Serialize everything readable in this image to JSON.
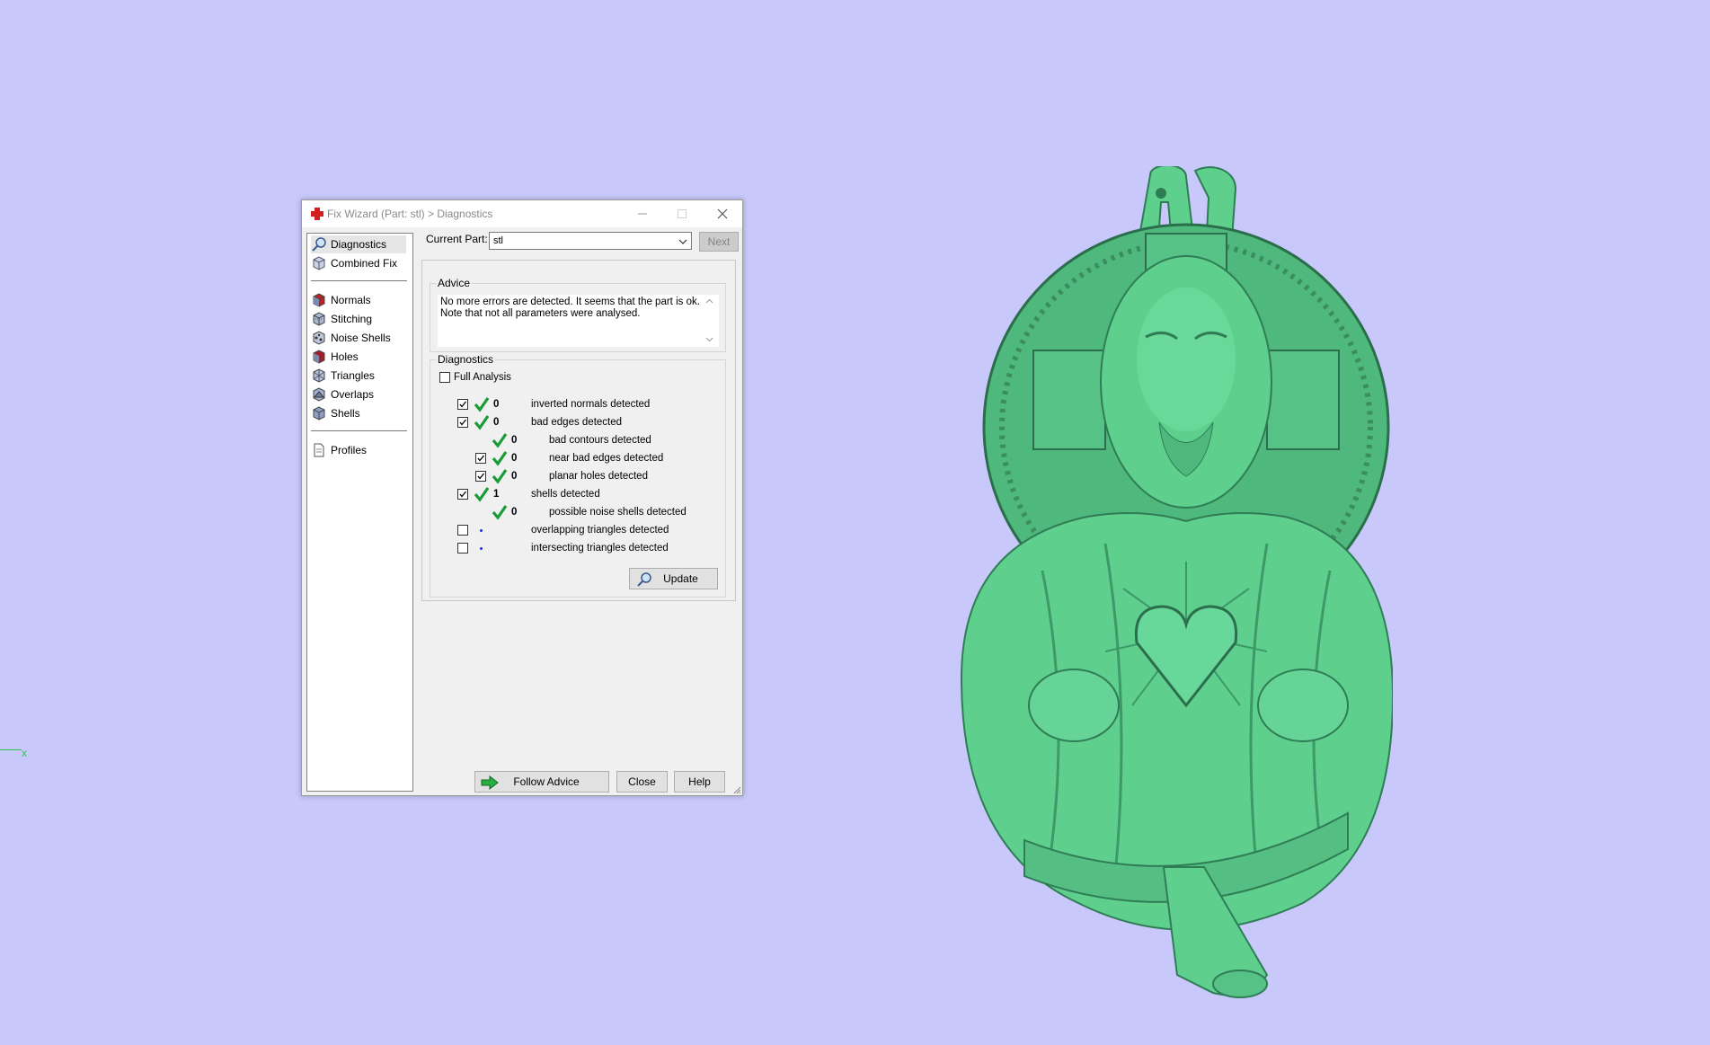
{
  "viewport": {
    "axis_label": "x",
    "background_color": "#c8c8fa",
    "model_color": "#5fcf8e"
  },
  "window": {
    "title": "Fix Wizard (Part: stl) > Diagnostics",
    "icon": "red-cross-icon",
    "controls": {
      "minimize": "minimize-icon",
      "maximize": "maximize-icon",
      "close": "close-icon"
    }
  },
  "sidebar": {
    "items_top": [
      {
        "label": "Diagnostics",
        "icon": "magnifier-icon",
        "selected": true
      },
      {
        "label": "Combined Fix",
        "icon": "cube-icon"
      }
    ],
    "items_mid": [
      {
        "label": "Normals",
        "icon": "normals-cube-icon"
      },
      {
        "label": "Stitching",
        "icon": "stitching-cube-icon"
      },
      {
        "label": "Noise Shells",
        "icon": "noise-shells-icon"
      },
      {
        "label": "Holes",
        "icon": "holes-cube-icon"
      },
      {
        "label": "Triangles",
        "icon": "triangles-icon"
      },
      {
        "label": "Overlaps",
        "icon": "overlaps-icon"
      },
      {
        "label": "Shells",
        "icon": "shells-icon"
      }
    ],
    "items_bottom": [
      {
        "label": "Profiles",
        "icon": "document-icon"
      }
    ]
  },
  "current_part": {
    "label": "Current Part:",
    "value": "stl",
    "next_label": "Next"
  },
  "advice": {
    "title": "Advice",
    "text": "No more errors are detected. It seems that the part is ok. Note that not all parameters were analysed."
  },
  "diagnostics": {
    "title": "Diagnostics",
    "full_analysis_label": "Full Analysis",
    "full_analysis_checked": false,
    "rows": [
      {
        "checkbox": true,
        "checked": true,
        "status": "ok",
        "count": "0",
        "text": "inverted normals detected",
        "indent": 0
      },
      {
        "checkbox": true,
        "checked": true,
        "status": "ok",
        "count": "0",
        "text": "bad edges detected",
        "indent": 0
      },
      {
        "checkbox": false,
        "checked": false,
        "status": "ok",
        "count": "0",
        "text": "bad contours detected",
        "indent": 1
      },
      {
        "checkbox": true,
        "checked": true,
        "status": "ok",
        "count": "0",
        "text": "near bad edges detected",
        "indent": 1
      },
      {
        "checkbox": true,
        "checked": true,
        "status": "ok",
        "count": "0",
        "text": "planar holes detected",
        "indent": 1
      },
      {
        "checkbox": true,
        "checked": true,
        "status": "ok",
        "count": "1",
        "text": "shells detected",
        "indent": 0
      },
      {
        "checkbox": false,
        "checked": false,
        "status": "ok",
        "count": "0",
        "text": "possible noise shells detected",
        "indent": 1
      },
      {
        "checkbox": true,
        "checked": false,
        "status": "pending",
        "count": "",
        "text": "overlapping triangles detected",
        "indent": 0
      },
      {
        "checkbox": true,
        "checked": false,
        "status": "pending",
        "count": "",
        "text": "intersecting triangles detected",
        "indent": 0
      }
    ],
    "update_label": "Update"
  },
  "footer": {
    "follow_advice_label": "Follow Advice",
    "close_label": "Close",
    "help_label": "Help"
  }
}
